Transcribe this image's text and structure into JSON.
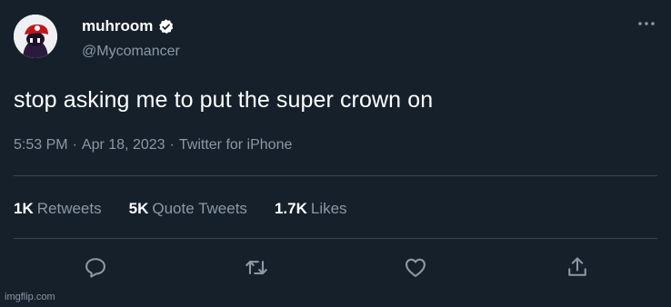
{
  "author": {
    "display_name": "muhroom",
    "handle": "@Mycomancer",
    "verified": true
  },
  "tweet": {
    "text": "stop asking me to put the super crown on",
    "time": "5:53 PM",
    "date": "Apr 18, 2023",
    "source": "Twitter for iPhone",
    "separator": "·"
  },
  "stats": {
    "retweets": {
      "count": "1K",
      "label": "Retweets"
    },
    "quote_tweets": {
      "count": "5K",
      "label": "Quote Tweets"
    },
    "likes": {
      "count": "1.7K",
      "label": "Likes"
    }
  },
  "actions": [
    "reply-icon",
    "retweet-icon",
    "like-icon",
    "share-icon"
  ],
  "colors": {
    "background": "#15202b",
    "primary_text": "#ffffff",
    "secondary_text": "#8b98a5",
    "divider": "#38444d",
    "verified_badge": "#ffffff"
  },
  "watermark": "imgflip.com"
}
